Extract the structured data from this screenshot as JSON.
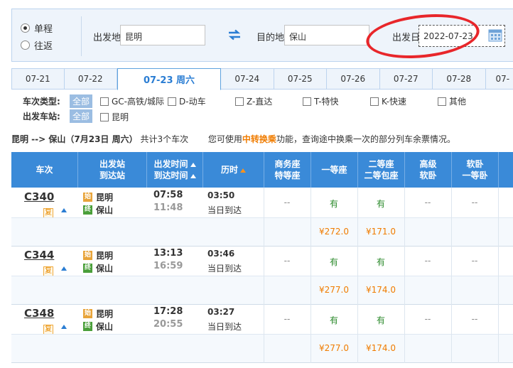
{
  "search": {
    "trip_type": {
      "one_way": "单程",
      "round_trip": "往返"
    },
    "from_label": "出发地",
    "from_value": "昆明",
    "to_label": "目的地",
    "to_value": "保山",
    "date_label": "出发日",
    "date_value": "2022-07-23"
  },
  "date_tabs": [
    "07-21",
    "07-22",
    "07-23 周六",
    "07-24",
    "07-25",
    "07-26",
    "07-27",
    "07-28",
    "07-"
  ],
  "filters": {
    "train_type_label": "车次类型:",
    "all_label": "全部",
    "train_types": [
      "GC-高铁/城际",
      "D-动车",
      "Z-直达",
      "T-特快",
      "K-快速",
      "其他"
    ],
    "depart_station_label": "出发车站:",
    "depart_stations": [
      "昆明"
    ]
  },
  "summary": {
    "route": "昆明 --> 保山（7月23日  周六）",
    "count_text": "共计3个车次",
    "tip_prefix": "您可使用",
    "tip_link": "中转换乘",
    "tip_suffix": "功能，查询途中换乘一次的部分列车余票情况。"
  },
  "table_header": {
    "train_no": "车次",
    "station_1": "出发站",
    "station_2": "到达站",
    "time_1": "出发时间",
    "time_2": "到达时间",
    "duration": "历时",
    "business_1": "商务座",
    "business_2": "特等座",
    "first": "一等座",
    "second_1": "二等座",
    "second_2": "二等包座",
    "premium_1": "高级",
    "premium_2": "软卧",
    "soft_1": "软卧",
    "soft_2": "一等卧"
  },
  "trains": [
    {
      "no": "C340",
      "fu": "复",
      "from_icon": "始",
      "to_icon": "终",
      "from": "昆明",
      "to": "保山",
      "depart": "07:58",
      "arrive": "11:48",
      "duration": "03:50",
      "arrive_day": "当日到达",
      "business": "--",
      "first": "有",
      "second": "有",
      "premium": "--",
      "soft": "--",
      "first_price": "¥272.0",
      "second_price": "¥171.0"
    },
    {
      "no": "C344",
      "fu": "复",
      "from_icon": "始",
      "to_icon": "终",
      "from": "昆明",
      "to": "保山",
      "depart": "13:13",
      "arrive": "16:59",
      "duration": "03:46",
      "arrive_day": "当日到达",
      "business": "--",
      "first": "有",
      "second": "有",
      "premium": "--",
      "soft": "--",
      "first_price": "¥277.0",
      "second_price": "¥174.0"
    },
    {
      "no": "C348",
      "fu": "复",
      "from_icon": "始",
      "to_icon": "终",
      "from": "昆明",
      "to": "保山",
      "depart": "17:28",
      "arrive": "20:55",
      "duration": "03:27",
      "arrive_day": "当日到达",
      "business": "--",
      "first": "有",
      "second": "有",
      "premium": "--",
      "soft": "--",
      "first_price": "¥277.0",
      "second_price": "¥174.0"
    }
  ],
  "colors": {
    "header_blue": "#3a8ad8",
    "accent_orange": "#f07c00",
    "available_green": "#2b8a2b",
    "annotation_red": "#e8262a"
  }
}
